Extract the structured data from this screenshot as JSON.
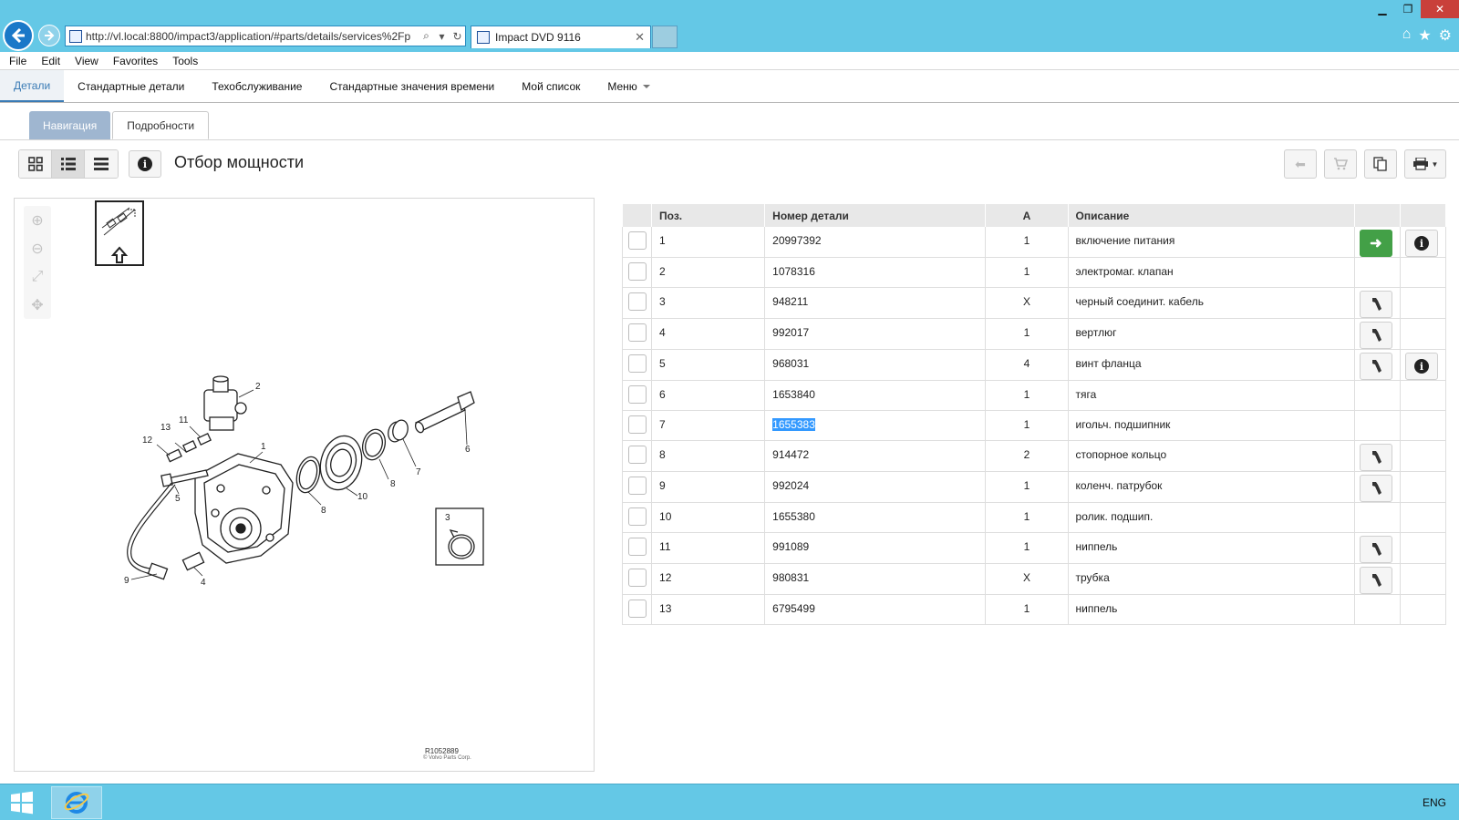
{
  "browser": {
    "url": "http://vl.local:8800/impact3/application/#parts/details/services%2Fp",
    "tab_title": "Impact DVD 9116",
    "menu": [
      "File",
      "Edit",
      "View",
      "Favorites",
      "Tools"
    ]
  },
  "nav": {
    "items": [
      "Детали",
      "Стандартные детали",
      "Техобслуживание",
      "Стандартные значения времени",
      "Мой список",
      "Меню"
    ]
  },
  "subtabs": [
    "Навигация",
    "Подробности"
  ],
  "page": {
    "title": "Отбор мощности"
  },
  "diagram": {
    "labels": [
      "1",
      "2",
      "3",
      "4",
      "5",
      "6",
      "7",
      "8",
      "8",
      "9",
      "10",
      "11",
      "12",
      "13"
    ],
    "figure_ref": "R1052889",
    "copyright": "© Volvo Parts Corp."
  },
  "table": {
    "headers": [
      "Поз.",
      "Номер детали",
      "А",
      "Описание"
    ],
    "rows": [
      {
        "pos": "1",
        "num": "20997392",
        "qty": "1",
        "desc": "включение питания",
        "action": "arrow",
        "info": true
      },
      {
        "pos": "2",
        "num": "1078316",
        "qty": "1",
        "desc": "электромаг. клапан",
        "action": "",
        "info": false
      },
      {
        "pos": "3",
        "num": "948211",
        "qty": "X",
        "desc": "черный соединит. кабель",
        "action": "tool",
        "info": false
      },
      {
        "pos": "4",
        "num": "992017",
        "qty": "1",
        "desc": "вертлюг",
        "action": "tool",
        "info": false
      },
      {
        "pos": "5",
        "num": "968031",
        "qty": "4",
        "desc": "винт фланца",
        "action": "tool",
        "info": true
      },
      {
        "pos": "6",
        "num": "1653840",
        "qty": "1",
        "desc": "тяга",
        "action": "",
        "info": false
      },
      {
        "pos": "7",
        "num": "1655383",
        "qty": "1",
        "desc": "игольч. подшипник",
        "action": "",
        "info": false
      },
      {
        "pos": "8",
        "num": "914472",
        "qty": "2",
        "desc": "стопорное кольцо",
        "action": "tool",
        "info": false
      },
      {
        "pos": "9",
        "num": "992024",
        "qty": "1",
        "desc": "коленч. патрубок",
        "action": "tool",
        "info": false
      },
      {
        "pos": "10",
        "num": "1655380",
        "qty": "1",
        "desc": "ролик. подшип.",
        "action": "",
        "info": false
      },
      {
        "pos": "11",
        "num": "991089",
        "qty": "1",
        "desc": "ниппель",
        "action": "tool",
        "info": false
      },
      {
        "pos": "12",
        "num": "980831",
        "qty": "X",
        "desc": "трубка",
        "action": "tool",
        "info": false
      },
      {
        "pos": "13",
        "num": "6795499",
        "qty": "1",
        "desc": "ниппель",
        "action": "",
        "info": false
      }
    ]
  },
  "taskbar": {
    "lang": "ENG"
  },
  "colors": {
    "accent": "#3a7bb5",
    "green": "#43a047",
    "chrome": "#64c8e6"
  }
}
